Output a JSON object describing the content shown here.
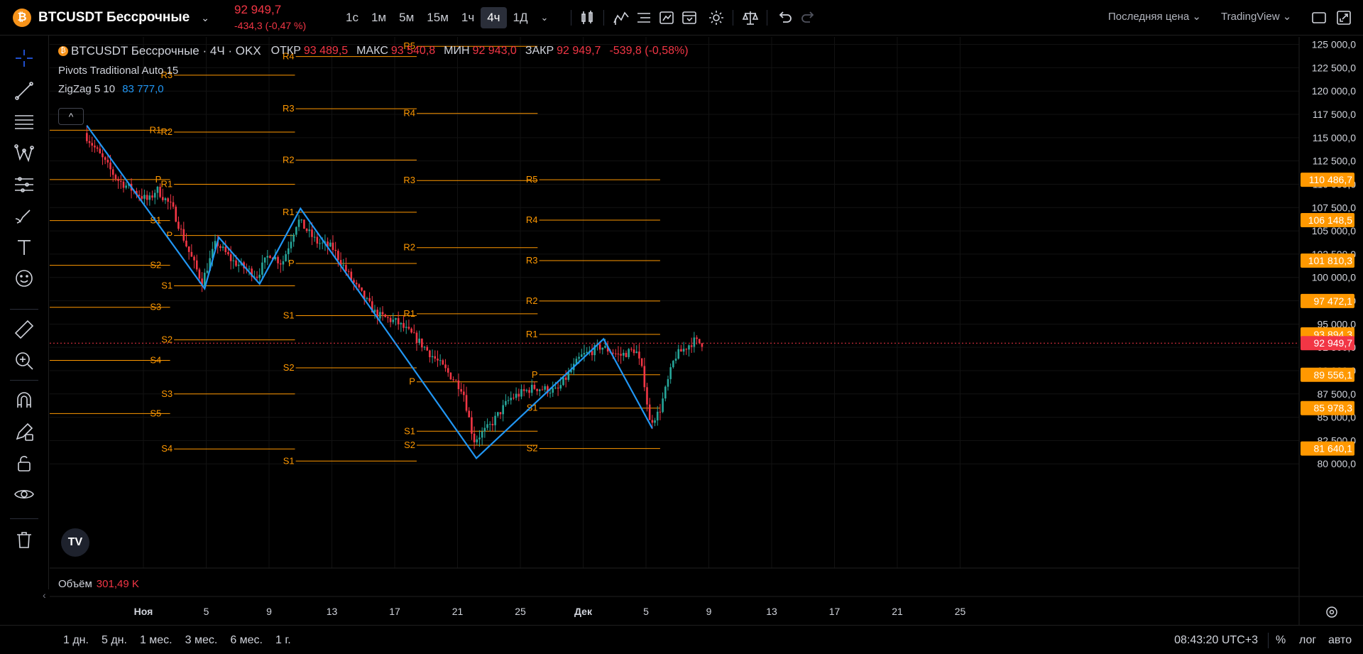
{
  "header": {
    "coin_icon": "bitcoin-icon",
    "symbol": "BTCUSDT Бессрочные",
    "price": "92 949,7",
    "change": "-434,3 (-0,47 %)",
    "timeframes": [
      "1с",
      "1м",
      "5м",
      "15м",
      "1ч",
      "4ч",
      "1Д"
    ],
    "active_timeframe": "4ч",
    "price_type": "Последняя цена",
    "feed": "TradingView"
  },
  "legend": {
    "title": "BTCUSDT Бессрочные · 4Ч · OKX",
    "open_label": "ОТКР",
    "open": "93 489,5",
    "high_label": "МАКС",
    "high": "93 540,8",
    "low_label": "МИН",
    "low": "92 943,0",
    "close_label": "ЗАКР",
    "close": "92 949,7",
    "change": "-539,8 (-0,58%)",
    "pivots": "Pivots Traditional Auto 15",
    "zigzag": "ZigZag 5 10",
    "zigzag_value": "83 777,0"
  },
  "volume": {
    "label": "Объём",
    "value": "301,49 K"
  },
  "price_axis": {
    "ticks": [
      "125 000,0",
      "122 500,0",
      "120 000,0",
      "117 500,0",
      "115 000,0",
      "112 500,0",
      "110 000,0",
      "107 500,0",
      "105 000,0",
      "102 500,0",
      "100 000,0",
      "97 500,0",
      "95 000,0",
      "92 500,0",
      "90 000,0",
      "87 500,0",
      "85 000,0",
      "82 500,0",
      "80 000,0"
    ],
    "badges": [
      {
        "text": "110 486,7",
        "value": 110486.7,
        "color": "#ff9800"
      },
      {
        "text": "106 148,5",
        "value": 106148.5,
        "color": "#ff9800"
      },
      {
        "text": "101 810,3",
        "value": 101810.3,
        "color": "#ff9800"
      },
      {
        "text": "97 472,1",
        "value": 97472.1,
        "color": "#ff9800"
      },
      {
        "text": "93 894,3",
        "value": 93894.3,
        "color": "#ff9800"
      },
      {
        "text": "92 949,7",
        "value": 92949.7,
        "color": "#f23645"
      },
      {
        "text": "89 556,1",
        "value": 89556.1,
        "color": "#ff9800"
      },
      {
        "text": "85 978,3",
        "value": 85978.3,
        "color": "#ff9800"
      },
      {
        "text": "81 640,1",
        "value": 81640.1,
        "color": "#ff9800"
      }
    ]
  },
  "time_axis": [
    "Ноя",
    "5",
    "9",
    "13",
    "17",
    "21",
    "25",
    "Дек",
    "5",
    "9",
    "13",
    "17",
    "21",
    "25"
  ],
  "ranges": [
    "1 дн.",
    "5 дн.",
    "1 мес.",
    "3 мес.",
    "6 мес.",
    "1 г."
  ],
  "clock": "08:43:20 UTC+3",
  "scale": {
    "percent": "%",
    "log": "лог",
    "auto": "авто"
  },
  "colors": {
    "up": "#26a69a",
    "down": "#f23645",
    "pivot": "#ff9800",
    "zigzag": "#2196f3"
  },
  "pivot_periods": [
    {
      "labels": [
        "R1",
        "P",
        "S1",
        "S2",
        "S3",
        "S4",
        "S5"
      ],
      "values": [
        115800,
        110500,
        106100,
        101300,
        96800,
        91100,
        85400
      ]
    },
    {
      "labels": [
        "R3",
        "R2",
        "R1",
        "P",
        "S1",
        "S2",
        "S3",
        "S4"
      ],
      "values": [
        121700,
        115600,
        110000,
        104500,
        99100,
        93300,
        87500,
        81600
      ]
    },
    {
      "labels": [
        "R4",
        "R3",
        "R2",
        "R1",
        "P",
        "S1",
        "S2",
        "S1"
      ],
      "values": [
        123700,
        118100,
        112600,
        107000,
        101500,
        95900,
        90300,
        80300
      ]
    },
    {
      "labels": [
        "R5",
        "R4",
        "R3",
        "R2",
        "R1",
        "P",
        "S1",
        "S2"
      ],
      "values": [
        124800,
        117600,
        110400,
        103200,
        96100,
        88800,
        83500,
        82000
      ]
    },
    {
      "labels": [
        "R5",
        "R4",
        "R3",
        "R2",
        "R1",
        "P",
        "S1",
        "S2"
      ],
      "values": [
        110486.7,
        106148.5,
        101810.3,
        97472.1,
        93894.3,
        89556.1,
        85978.3,
        81640.1
      ]
    }
  ],
  "zigzag_points": [
    {
      "day": -3.6,
      "price": 116300
    },
    {
      "day": 3.9,
      "price": 98800
    },
    {
      "day": 4.8,
      "price": 104300
    },
    {
      "day": 7.4,
      "price": 99300
    },
    {
      "day": 10.0,
      "price": 107400
    },
    {
      "day": 21.2,
      "price": 80600
    },
    {
      "day": 29.3,
      "price": 93400
    },
    {
      "day": 32.4,
      "price": 83800
    }
  ],
  "price_path": [
    {
      "day": -3.6,
      "price": 115500
    },
    {
      "day": -1.5,
      "price": 110500
    },
    {
      "day": 0.5,
      "price": 108200
    },
    {
      "day": 1.0,
      "price": 109500
    },
    {
      "day": 2.0,
      "price": 107500
    },
    {
      "day": 3.0,
      "price": 103000
    },
    {
      "day": 3.9,
      "price": 99500
    },
    {
      "day": 4.8,
      "price": 103800
    },
    {
      "day": 5.8,
      "price": 101800
    },
    {
      "day": 7.4,
      "price": 100200
    },
    {
      "day": 8.2,
      "price": 102600
    },
    {
      "day": 9.0,
      "price": 101500
    },
    {
      "day": 10.0,
      "price": 106200
    },
    {
      "day": 11.2,
      "price": 103800
    },
    {
      "day": 12.2,
      "price": 103200
    },
    {
      "day": 13.5,
      "price": 99500
    },
    {
      "day": 15.0,
      "price": 96000
    },
    {
      "day": 16.3,
      "price": 95200
    },
    {
      "day": 17.5,
      "price": 93500
    },
    {
      "day": 19.0,
      "price": 90800
    },
    {
      "day": 20.5,
      "price": 88000
    },
    {
      "day": 21.2,
      "price": 82500
    },
    {
      "day": 22.2,
      "price": 84000
    },
    {
      "day": 23.5,
      "price": 87000
    },
    {
      "day": 25.0,
      "price": 88200
    },
    {
      "day": 26.5,
      "price": 87800
    },
    {
      "day": 28.0,
      "price": 91500
    },
    {
      "day": 29.3,
      "price": 92600
    },
    {
      "day": 30.5,
      "price": 91600
    },
    {
      "day": 31.5,
      "price": 92300
    },
    {
      "day": 32.0,
      "price": 89500
    },
    {
      "day": 32.4,
      "price": 84500
    },
    {
      "day": 33.0,
      "price": 85500
    },
    {
      "day": 34.0,
      "price": 91500
    },
    {
      "day": 35.2,
      "price": 93200
    },
    {
      "day": 35.6,
      "price": 92950
    }
  ]
}
